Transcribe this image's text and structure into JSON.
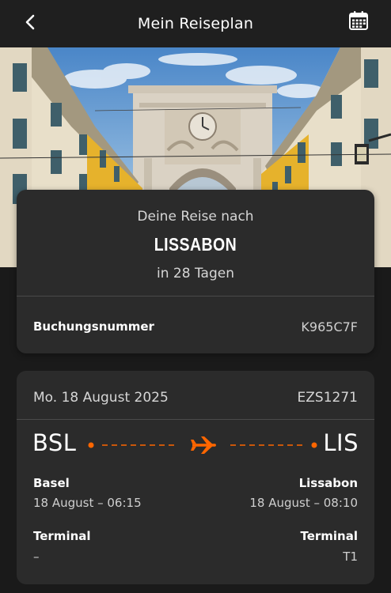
{
  "header": {
    "title": "Mein Reiseplan",
    "back_icon": "chevron-left-icon",
    "calendar_icon": "calendar-icon"
  },
  "trip": {
    "subtitle": "Deine Reise nach",
    "destination": "LISSABON",
    "countdown": "in 28 Tagen",
    "booking_label": "Buchungsnummer",
    "booking_number": "K965C7F"
  },
  "flight": {
    "date": "Mo. 18 August 2025",
    "flight_number": "EZS1271",
    "origin": {
      "code": "BSL",
      "city": "Basel",
      "datetime": "18 August – 06:15",
      "terminal_label": "Terminal",
      "terminal": "–"
    },
    "destination": {
      "code": "LIS",
      "city": "Lissabon",
      "datetime": "18 August – 08:10",
      "terminal_label": "Terminal",
      "terminal": "T1"
    },
    "plane_icon": "airplane-icon"
  },
  "colors": {
    "accent": "#ff6600",
    "background": "#1a1a1a",
    "card": "#2b2b2b",
    "header": "#1f1f1f"
  }
}
